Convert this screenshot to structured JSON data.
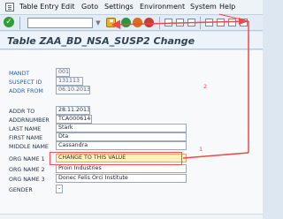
{
  "menu": {
    "items": [
      "Table Entry",
      "Edit",
      "Goto",
      "Settings",
      "Environment",
      "System",
      "Help"
    ]
  },
  "toolbar": {
    "command_value": "",
    "dropdown_glyph": "▼",
    "check_glyph": "✓"
  },
  "header": {
    "title": "Table ZAA_BD_NSA_SUSP2 Change"
  },
  "form": {
    "mandt_label": "MANDT",
    "mandt_value": "001",
    "suspect_id_label": "SUSPECT ID",
    "suspect_id_value": "131113",
    "addr_from_label": "ADDR FROM",
    "addr_from_value": "06.10.2013",
    "addr_to_label": "ADDR TO",
    "addr_to_value": "28.11.2013",
    "addrnumber_label": "ADDRNUMBER",
    "addrnumber_value": "TCA0006148",
    "last_name_label": "LAST NAME",
    "last_name_value": "Stark",
    "first_name_label": "FIRST NAME",
    "first_name_value": "Dta",
    "middle_name_label": "MIDDLE NAME",
    "middle_name_value": "Cassandra",
    "org_name_1_label": "ORG NAME 1",
    "org_name_1_value": "CHANGE TO THIS VALUE",
    "org_name_2_label": "ORG NAME 2",
    "org_name_2_value": "Proin Industries",
    "org_name_3_label": "ORG NAME 3",
    "org_name_3_value": "Donec Felis Orci Institute",
    "gender_label": "GENDER",
    "gender_value": "-"
  },
  "annotations": {
    "step_one": "1",
    "step_two": "2",
    "color": "#f04848"
  }
}
